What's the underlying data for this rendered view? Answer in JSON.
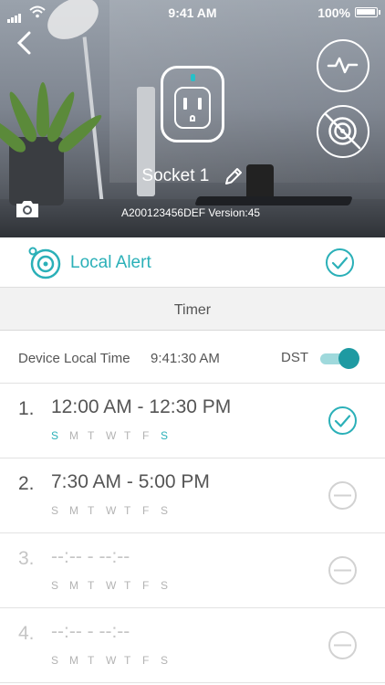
{
  "status_bar": {
    "time": "9:41 AM",
    "battery": "100%"
  },
  "device": {
    "name": "Socket 1",
    "meta": "A200123456DEF Version:45"
  },
  "local_alert": {
    "label": "Local Alert",
    "enabled": true
  },
  "tab": {
    "label": "Timer"
  },
  "local_time": {
    "label": "Device Local Time",
    "value": "9:41:30 AM",
    "dst_label": "DST",
    "dst_on": true
  },
  "colors": {
    "accent": "#2bb0b8",
    "toggle_knob": "#1e9aa2"
  },
  "timers": [
    {
      "index": "1.",
      "range": "12:00 AM - 12:30 PM",
      "days": [
        "S",
        "M",
        "T",
        "W",
        "T",
        "F",
        "S"
      ],
      "days_on": [
        true,
        false,
        false,
        false,
        false,
        false,
        true
      ],
      "enabled": true
    },
    {
      "index": "2.",
      "range": "7:30 AM - 5:00 PM",
      "days": [
        "S",
        "M",
        "T",
        "W",
        "T",
        "F",
        "S"
      ],
      "days_on": [
        false,
        false,
        false,
        false,
        false,
        false,
        false
      ],
      "enabled": false
    },
    {
      "index": "3.",
      "range": "--:-- - --:--",
      "days": [
        "S",
        "M",
        "T",
        "W",
        "T",
        "F",
        "S"
      ],
      "days_on": [
        false,
        false,
        false,
        false,
        false,
        false,
        false
      ],
      "enabled": false
    },
    {
      "index": "4.",
      "range": "--:-- - --:--",
      "days": [
        "S",
        "M",
        "T",
        "W",
        "T",
        "F",
        "S"
      ],
      "days_on": [
        false,
        false,
        false,
        false,
        false,
        false,
        false
      ],
      "enabled": false
    }
  ],
  "icons": {
    "back": "chevron-left-icon",
    "activity": "pulse-icon",
    "no_cloud": "no-signal-icon",
    "edit": "pencil-icon",
    "camera": "camera-icon",
    "alert": "alert-icon",
    "check": "check-circle-icon",
    "disabled": "minus-circle-icon"
  }
}
